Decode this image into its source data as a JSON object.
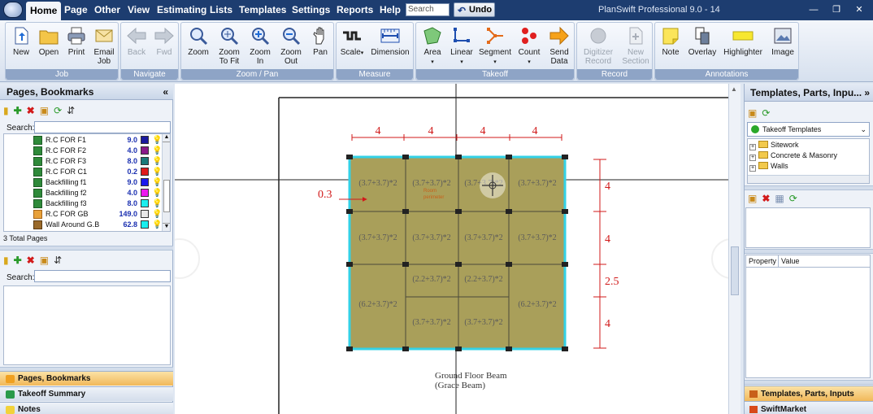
{
  "menu": [
    "Home",
    "Page",
    "Other",
    "View",
    "Estimating",
    "Lists",
    "Templates",
    "Settings",
    "Reports",
    "Help"
  ],
  "search_placeholder": "Search",
  "undo_label": "Undo",
  "app_title": "PlanSwift Professional 9.0 - 14",
  "window_buttons": {
    "minimize": "—",
    "restore": "❐",
    "close": "✕"
  },
  "ribbon": {
    "groups": [
      "Job",
      "Navigate",
      "Zoom / Pan",
      "Measure",
      "Takeoff",
      "Record",
      "Annotations"
    ],
    "job": [
      "New",
      "Open",
      "Print",
      "Email\nJob"
    ],
    "navigate": [
      "Back",
      "Fwd"
    ],
    "zoom": [
      "Zoom",
      "Zoom\nTo Fit",
      "Zoom\nIn",
      "Zoom\nOut",
      "Pan"
    ],
    "measure": [
      "Scale",
      "Dimension"
    ],
    "takeoff": [
      "Area",
      "Linear",
      "Segment",
      "Count",
      "Send\nData"
    ],
    "record": [
      "Digitizer\nRecord",
      "New\nSection"
    ],
    "annotations": [
      "Note",
      "Overlay",
      "Highlighter",
      "Image"
    ]
  },
  "left_panel": {
    "title": "Pages, Bookmarks",
    "collapse": "«",
    "search_label": "Search:",
    "pages": [
      {
        "name": "R.C FOR F1",
        "value": "9.0",
        "color": "#1a1a9e"
      },
      {
        "name": "R.C FOR F2",
        "value": "4.0",
        "color": "#8a1a8a"
      },
      {
        "name": "R.C FOR F3",
        "value": "8.0",
        "color": "#1a7a7a"
      },
      {
        "name": "R.C FOR C1",
        "value": "0.2",
        "color": "#e01a1a"
      },
      {
        "name": "Backfilling f1",
        "value": "9.0",
        "color": "#1a1aee"
      },
      {
        "name": "Backfilling f2",
        "value": "4.0",
        "color": "#ee1aee"
      },
      {
        "name": "Backfilling f3",
        "value": "8.0",
        "color": "#1aeeee"
      },
      {
        "name": "R.C FOR GB",
        "value": "149.0",
        "color": "#e8e8e8"
      },
      {
        "name": "Wall Around G.B",
        "value": "62.8",
        "color": "#1aeeee"
      }
    ],
    "total_pages": "3 Total Pages",
    "search2_label": "Search:",
    "tabs": [
      "Pages, Bookmarks",
      "Takeoff Summary",
      "Notes"
    ]
  },
  "drawing": {
    "top_dims": [
      "4",
      "4",
      "4",
      "4"
    ],
    "right_dims": [
      "4",
      "4",
      "2.5",
      "4"
    ],
    "left_dim": "0.3",
    "cells": [
      [
        "(3.7+3.7)*2",
        "(3.7+3.7)*2",
        "(3.7+3.7)*2",
        "(3.7+3.7)*2"
      ],
      [
        "(3.7+3.7)*2",
        "(3.7+3.7)*2",
        "(3.7+3.7)*2",
        "(3.7+3.7)*2"
      ],
      [
        "(6.2+3.7)*2",
        "(2.2+3.7)*2",
        "(2.2+3.7)*2",
        "(6.2+3.7)*2"
      ],
      [
        "",
        "(3.7+3.7)*2",
        "(3.7+3.7)*2",
        ""
      ]
    ],
    "room_label": "Room\nperimeter",
    "caption1": "Ground Floor Beam",
    "caption2": "(Grace Beam)",
    "fill_color": "#a99f5a",
    "border_color": "#33d1e6"
  },
  "right_panel": {
    "title": "Templates, Parts, Inpu...",
    "collapse": "»",
    "select_value": "Takeoff Templates",
    "tree": [
      "Sitework",
      "Concrete & Masonry",
      "Walls"
    ],
    "prop_headers": [
      "Property",
      "Value"
    ],
    "tabs": [
      "Templates, Parts, Inputs",
      "SwiftMarket"
    ]
  }
}
